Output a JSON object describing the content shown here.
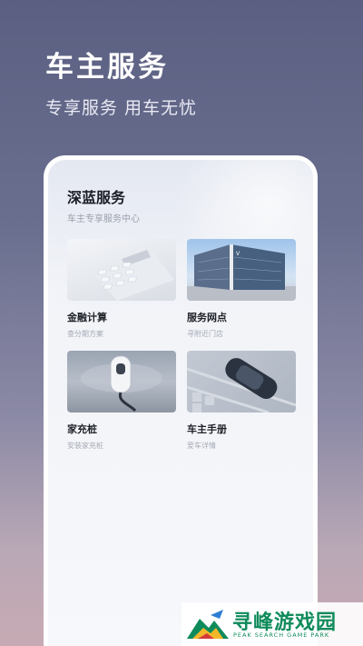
{
  "hero": {
    "title": "车主服务",
    "subtitle": "专享服务 用车无忧"
  },
  "panel": {
    "title": "深蓝服务",
    "subtitle": "车主专享服务中心",
    "cards": [
      {
        "label": "金融计算",
        "desc": "查分期方案",
        "image": "calculator-image"
      },
      {
        "label": "服务网点",
        "desc": "寻附近门店",
        "image": "store-building-image"
      },
      {
        "label": "家充桩",
        "desc": "安装家充桩",
        "image": "home-charger-image"
      },
      {
        "label": "车主手册",
        "desc": "爱车详情",
        "image": "car-top-view-image"
      }
    ]
  },
  "watermark": {
    "title": "寻峰游戏园",
    "subtitle": "PEAK SEARCH GAME PARK"
  },
  "colors": {
    "brand_green": "#0f8b5b",
    "hero_text": "#ffffff"
  }
}
